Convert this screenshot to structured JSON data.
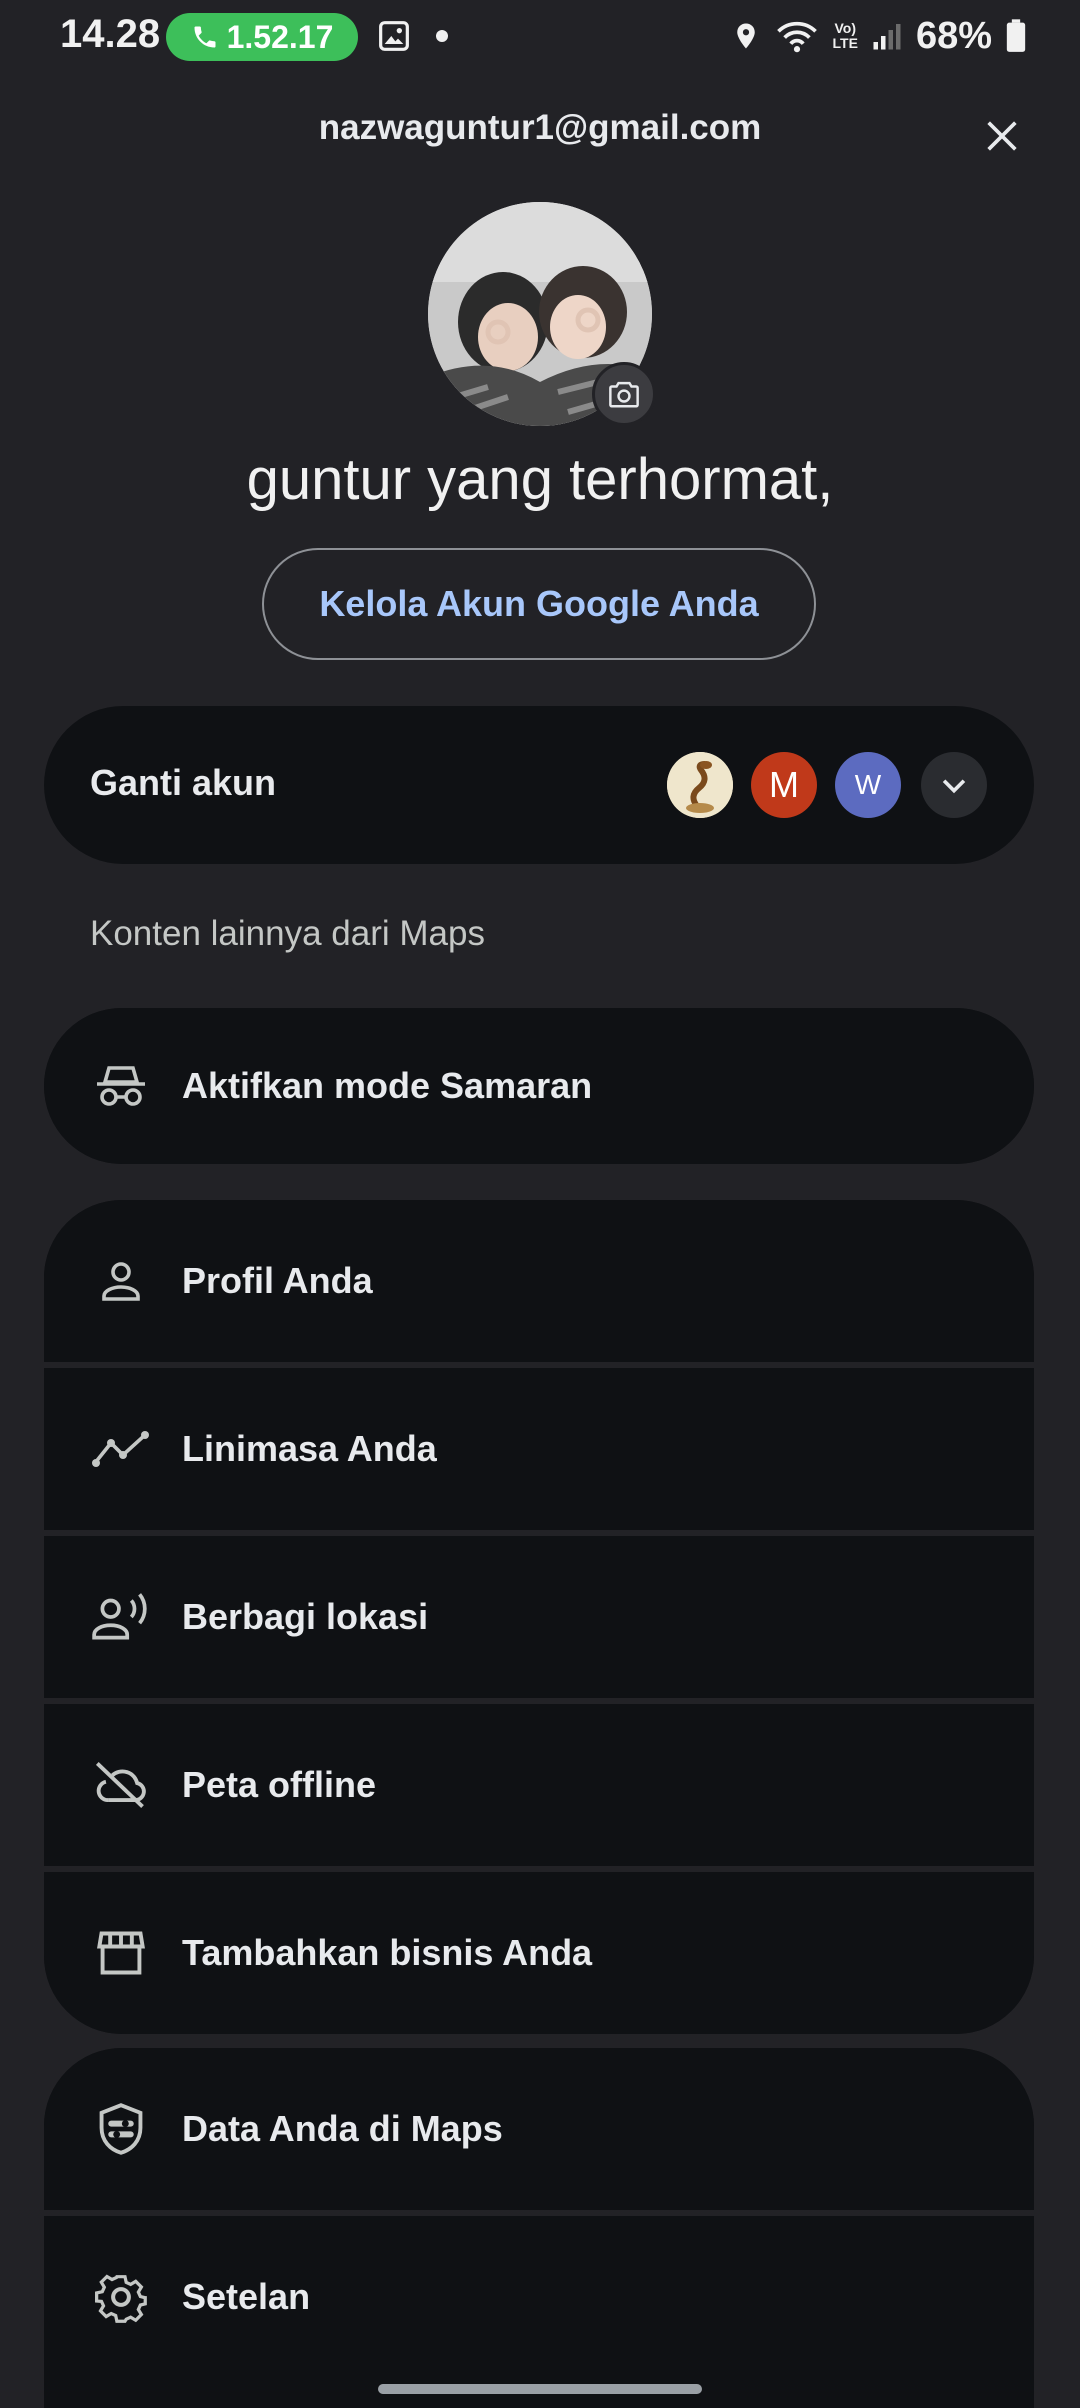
{
  "status_bar": {
    "time": "14.28",
    "call_duration": "1.52.17",
    "lte_top": "Vo)",
    "lte_bottom": "LTE",
    "battery": "68%",
    "icons": [
      "phone-icon",
      "gallery-icon",
      "location-icon",
      "wifi-icon",
      "signal-icon",
      "battery-icon"
    ]
  },
  "header": {
    "email": "nazwaguntur1@gmail.com",
    "greeting": "guntur yang terhormat,",
    "manage_button": "Kelola Akun Google Anda"
  },
  "switch_account": {
    "label": "Ganti akun",
    "accounts": [
      {
        "initial": "",
        "color": "#e8dcb8"
      },
      {
        "initial": "M",
        "color": "#c0391a"
      },
      {
        "initial": "W",
        "color": "#5c6bc0"
      }
    ]
  },
  "section_label": "Konten lainnya dari Maps",
  "menu": {
    "incognito": "Aktifkan mode Samaran",
    "profile": "Profil Anda",
    "timeline": "Linimasa Anda",
    "location_sharing": "Berbagi lokasi",
    "offline_maps": "Peta offline",
    "add_business": "Tambahkan bisnis Anda",
    "your_data": "Data Anda di Maps",
    "settings": "Setelan"
  },
  "colors": {
    "background": "#222226",
    "card": "#0f1114",
    "accent_link": "#a8c7fa",
    "call_pill": "#3dbf5a"
  }
}
